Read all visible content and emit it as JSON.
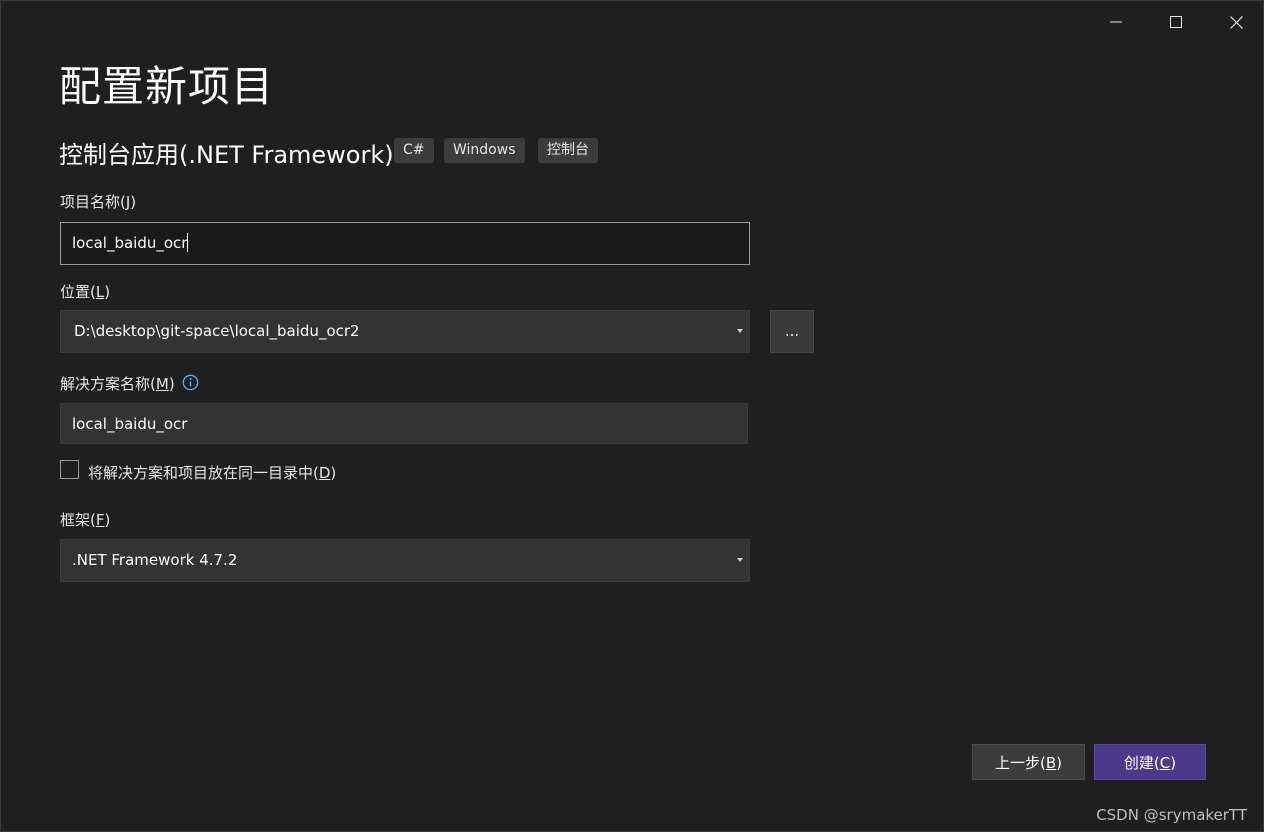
{
  "window": {
    "title": "配置新项目"
  },
  "template": {
    "name": "控制台应用(.NET Framework)",
    "tags": [
      "C#",
      "Windows",
      "控制台"
    ]
  },
  "project_name": {
    "label_text": "项目名称(",
    "label_key": "J",
    "label_end": ")",
    "value": "local_baidu_ocr"
  },
  "location": {
    "label_text": "位置(",
    "label_key": "L",
    "label_end": ")",
    "value": "D:\\desktop\\git-space\\local_baidu_ocr2",
    "browse_label": "..."
  },
  "solution_name": {
    "label_text": "解决方案名称(",
    "label_key": "M",
    "label_end": ")",
    "value": "local_baidu_ocr"
  },
  "same_directory": {
    "label_text": "将解决方案和项目放在同一目录中(",
    "label_key": "D",
    "label_end": ")",
    "checked": false
  },
  "framework": {
    "label_text": "框架(",
    "label_key": "F",
    "label_end": ")",
    "value": ".NET Framework 4.7.2"
  },
  "footer": {
    "back_text": "上一步(",
    "back_key": "B",
    "back_end": ")",
    "create_text": "创建(",
    "create_key": "C",
    "create_end": ")"
  },
  "watermark": "CSDN @srymakerTT",
  "colors": {
    "background": "#1f1f1f",
    "accent": "#4b3a8c",
    "info": "#4fb3ff"
  },
  "icons": {
    "minimize": "minimize-icon",
    "maximize": "maximize-icon",
    "close": "close-icon",
    "info": "info-icon",
    "dropdown": "chevron-down-icon"
  }
}
